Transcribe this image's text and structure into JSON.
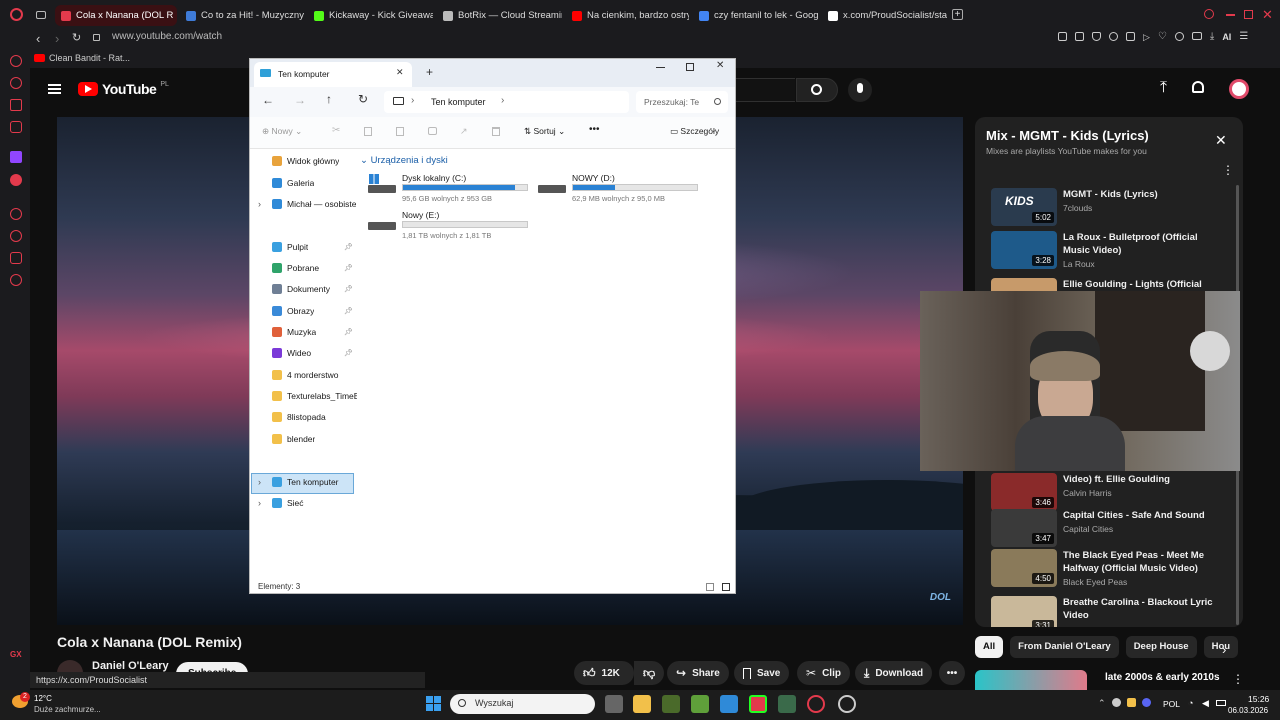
{
  "browser": {
    "tabs": [
      {
        "label": "Cola x Nanana (DOL R",
        "color": "#e33a4c"
      },
      {
        "label": "Co to za Hit! - Muzyczny C",
        "color": "#3e7bd8"
      },
      {
        "label": "Kickaway - Kick Giveaway",
        "color": "#53fc18"
      },
      {
        "label": "BotRix — Cloud Streaming",
        "color": "#bbbbbb"
      },
      {
        "label": "Na cienkim, bardzo ostry",
        "color": "#ff0000"
      },
      {
        "label": "czy fentanil to lek - Googl",
        "color": "#4285f4"
      },
      {
        "label": "x.com/ProudSocialist/statu",
        "color": "#ffffff"
      }
    ],
    "address": "www.youtube.com/watch",
    "bookmark": "Clean Bandit - Rat...",
    "ai_label": "AI",
    "status_url": "https://x.com/ProudSocialist"
  },
  "youtube": {
    "logo_text": "YouTube",
    "logo_region": "PL",
    "video_title": "Cola x Nanana (DOL Remix)",
    "channel": "Daniel O'Leary",
    "subscribe": "Subscribe",
    "watermark": "DOL",
    "actions": {
      "likes": "12K",
      "share": "Share",
      "save": "Save",
      "clip": "Clip",
      "download": "Download"
    },
    "chips": [
      "All",
      "From Daniel O'Leary",
      "Deep House",
      "Hou"
    ],
    "up_next_title": "late 2000s & early 2010s"
  },
  "playlist": {
    "title": "Mix - MGMT - Kids (Lyrics)",
    "subtitle": "Mixes are playlists YouTube makes for you",
    "items": [
      {
        "title": "MGMT - Kids (Lyrics)",
        "artist": "7clouds",
        "duration": "5:02",
        "thumb_text": "KIDS",
        "thumb_color": "#2a3b4e"
      },
      {
        "title": "La Roux - Bulletproof (Official Music Video)",
        "artist": "La Roux",
        "duration": "3:28",
        "thumb_color": "#1e5a8a"
      },
      {
        "title": "Ellie Goulding - Lights (Official",
        "artist": "",
        "duration": "",
        "thumb_color": "#c79a6a"
      },
      {
        "title": "Video) ft. Ellie Goulding",
        "artist": "Calvin Harris",
        "duration": "3:46",
        "thumb_color": "#8a2a2a"
      },
      {
        "title": "Capital Cities - Safe And Sound",
        "artist": "Capital Cities",
        "duration": "3:47",
        "thumb_color": "#3a3a3a"
      },
      {
        "title": "The Black Eyed Peas - Meet Me Halfway (Official Music Video)",
        "artist": "Black Eyed Peas",
        "duration": "4:50",
        "thumb_color": "#8a7a5a"
      },
      {
        "title": "Breathe Carolina - Blackout Lyric Video",
        "artist": "",
        "duration": "3:31",
        "thumb_color": "#c9b89a"
      }
    ]
  },
  "explorer": {
    "tab_title": "Ten komputer",
    "breadcrumb": "Ten komputer",
    "search_placeholder": "Przeszukaj: Te",
    "cmd": {
      "new": "Nowy",
      "sort": "Sortuj",
      "details": "Szczegóły"
    },
    "section": "Urządzenia i dyski",
    "drives": [
      {
        "name": "Dysk lokalny (C:)",
        "info": "95,6 GB wolnych z 953 GB",
        "used": 0.9
      },
      {
        "name": "NOWY (D:)",
        "info": "62,9 MB wolnych z 95,0 MB",
        "used": 0.34
      },
      {
        "name": "Nowy (E:)",
        "info": "1,81 TB wolnych z 1,81 TB",
        "used": 0.0
      }
    ],
    "sidebar": [
      {
        "label": "Widok główny",
        "color": "#e8a33c"
      },
      {
        "label": "Galeria",
        "color": "#2f8ad8"
      },
      {
        "label": "Michał — osobiste",
        "color": "#2f8ad8"
      },
      {
        "label": "Pulpit",
        "color": "#3aa0e0"
      },
      {
        "label": "Pobrane",
        "color": "#2fa36a"
      },
      {
        "label": "Dokumenty",
        "color": "#6f7f95"
      },
      {
        "label": "Obrazy",
        "color": "#3a8ad8"
      },
      {
        "label": "Muzyka",
        "color": "#e0603a"
      },
      {
        "label": "Wideo",
        "color": "#7b3ad8"
      },
      {
        "label": "4 morderstwo",
        "color": "#f2c04a"
      },
      {
        "label": "Texturelabs_TimeBl",
        "color": "#f2c04a"
      },
      {
        "label": "8listopada",
        "color": "#f2c04a"
      },
      {
        "label": "blender",
        "color": "#f2c04a"
      },
      {
        "label": "Ten komputer",
        "color": "#3aa0e0"
      },
      {
        "label": "Sieć",
        "color": "#3aa0e0"
      }
    ],
    "status": "Elementy: 3"
  },
  "taskbar": {
    "weather_temp": "12°C",
    "weather_desc": "Duże zachmurze...",
    "weather_badge": "2",
    "search_placeholder": "Wyszukaj",
    "lang": "POL",
    "time": "15:26",
    "date": "06.03.2026"
  }
}
